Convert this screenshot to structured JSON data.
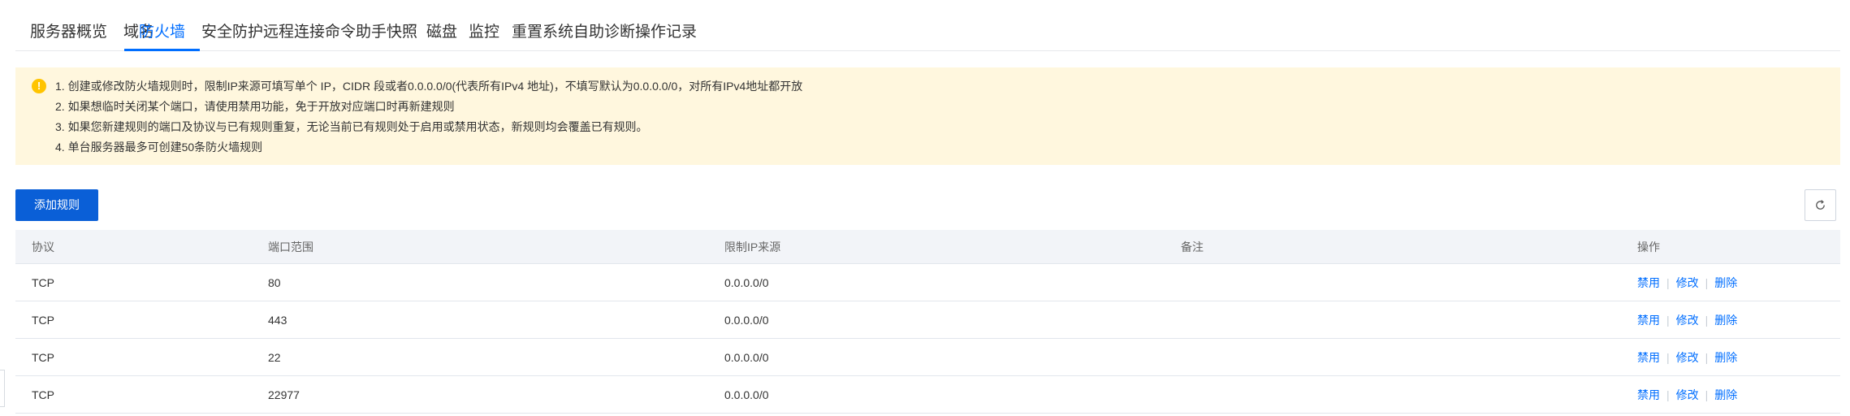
{
  "tabs": [
    {
      "label": "服务器概览"
    },
    {
      "label": "域名"
    },
    {
      "label": "防火墙",
      "active": true
    },
    {
      "label": "安全防护"
    },
    {
      "label": "远程连接"
    },
    {
      "label": "命令助手"
    },
    {
      "label": "快照"
    },
    {
      "label": "磁盘"
    },
    {
      "label": "监控"
    },
    {
      "label": "重置系统"
    },
    {
      "label": "自助诊断"
    },
    {
      "label": "操作记录"
    }
  ],
  "notice": {
    "icon": "warning-icon",
    "icon_glyph": "!",
    "lines": [
      "1. 创建或修改防火墙规则时，限制IP来源可填写单个 IP，CIDR 段或者0.0.0.0/0(代表所有IPv4 地址)，不填写默认为0.0.0.0/0，对所有IPv4地址都开放",
      "2. 如果想临时关闭某个端口，请使用禁用功能，免于开放对应端口时再新建规则",
      "3. 如果您新建规则的端口及协议与已有规则重复，无论当前已有规则处于启用或禁用状态，新规则均会覆盖已有规则。",
      "4. 单台服务器最多可创建50条防火墙规则"
    ]
  },
  "toolbar": {
    "add_label": "添加规则",
    "refresh_icon": "refresh-icon"
  },
  "table": {
    "headers": [
      "协议",
      "端口范围",
      "限制IP来源",
      "备注",
      "操作"
    ],
    "actions": {
      "disable": "禁用",
      "edit": "修改",
      "delete": "删除",
      "separator": "|"
    },
    "rows": [
      {
        "protocol": "TCP",
        "port": "80",
        "source": "0.0.0.0/0",
        "note": ""
      },
      {
        "protocol": "TCP",
        "port": "443",
        "source": "0.0.0.0/0",
        "note": ""
      },
      {
        "protocol": "TCP",
        "port": "22",
        "source": "0.0.0.0/0",
        "note": ""
      },
      {
        "protocol": "TCP",
        "port": "22977",
        "source": "0.0.0.0/0",
        "note": ""
      }
    ]
  },
  "colors": {
    "accent": "#006eff",
    "primary_button": "#0a5fd7",
    "notice_bg": "#fff7de",
    "warning_icon": "#ffc400",
    "table_header_bg": "#f2f4f8"
  }
}
